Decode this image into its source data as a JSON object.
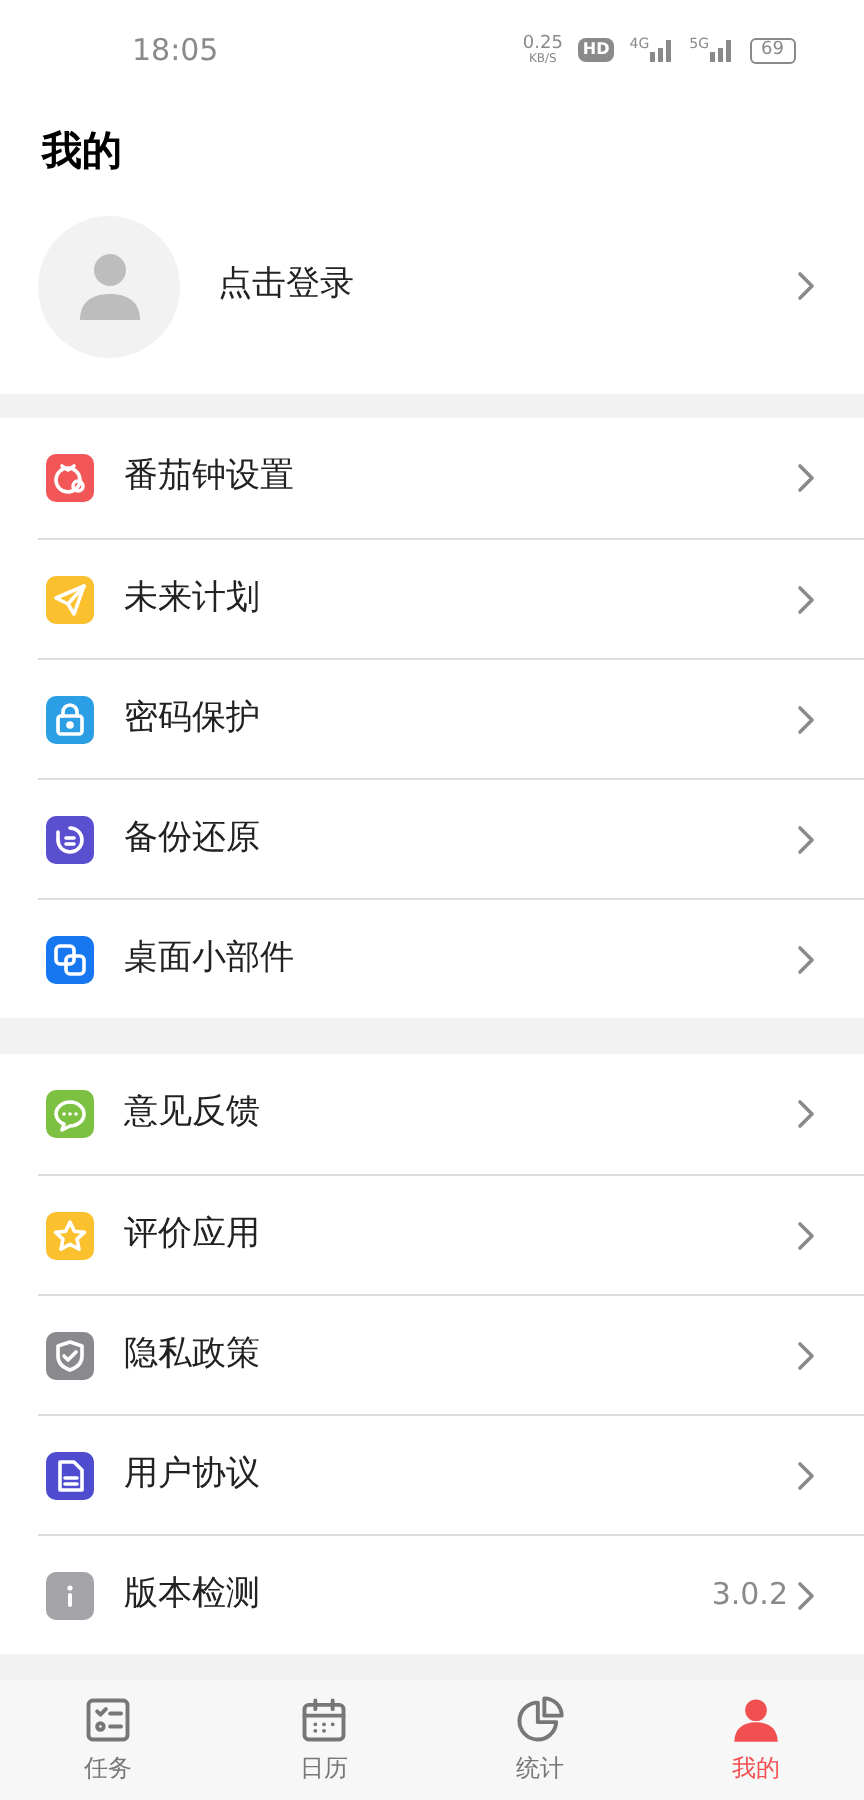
{
  "status_bar": {
    "time": "18:05",
    "speed": "0.25",
    "speed_unit": "KB/S",
    "hd": "HD",
    "net_1": "4G",
    "net_2": "5G",
    "battery": "69"
  },
  "title": "我的",
  "profile": {
    "label": "点击登录"
  },
  "sections": [
    {
      "items": [
        {
          "kind": "tomato",
          "color": "#f25656",
          "label": "番茄钟设置"
        },
        {
          "kind": "plane",
          "color": "#fbc02d",
          "label": "未来计划"
        },
        {
          "kind": "lock",
          "color": "#2b9ee6",
          "label": "密码保护"
        },
        {
          "kind": "restore",
          "color": "#5a4fcf",
          "label": "备份还原"
        },
        {
          "kind": "widget",
          "color": "#1677f0",
          "label": "桌面小部件"
        }
      ]
    },
    {
      "items": [
        {
          "kind": "chat",
          "color": "#7cc142",
          "label": "意见反馈"
        },
        {
          "kind": "star",
          "color": "#fbc02d",
          "label": "评价应用"
        },
        {
          "kind": "shield",
          "color": "#8a8a8e",
          "label": "隐私政策"
        },
        {
          "kind": "doc",
          "color": "#4f4ccf",
          "label": "用户协议"
        },
        {
          "kind": "info",
          "color": "#a3a3a8",
          "label": "版本检测",
          "value": "3.0.2"
        }
      ]
    }
  ],
  "tab_bar": [
    {
      "kind": "tasks",
      "label": "任务",
      "selected": false
    },
    {
      "kind": "calendar",
      "label": "日历",
      "selected": false
    },
    {
      "kind": "stats",
      "label": "统计",
      "selected": false
    },
    {
      "kind": "me",
      "label": "我的",
      "selected": true
    }
  ]
}
